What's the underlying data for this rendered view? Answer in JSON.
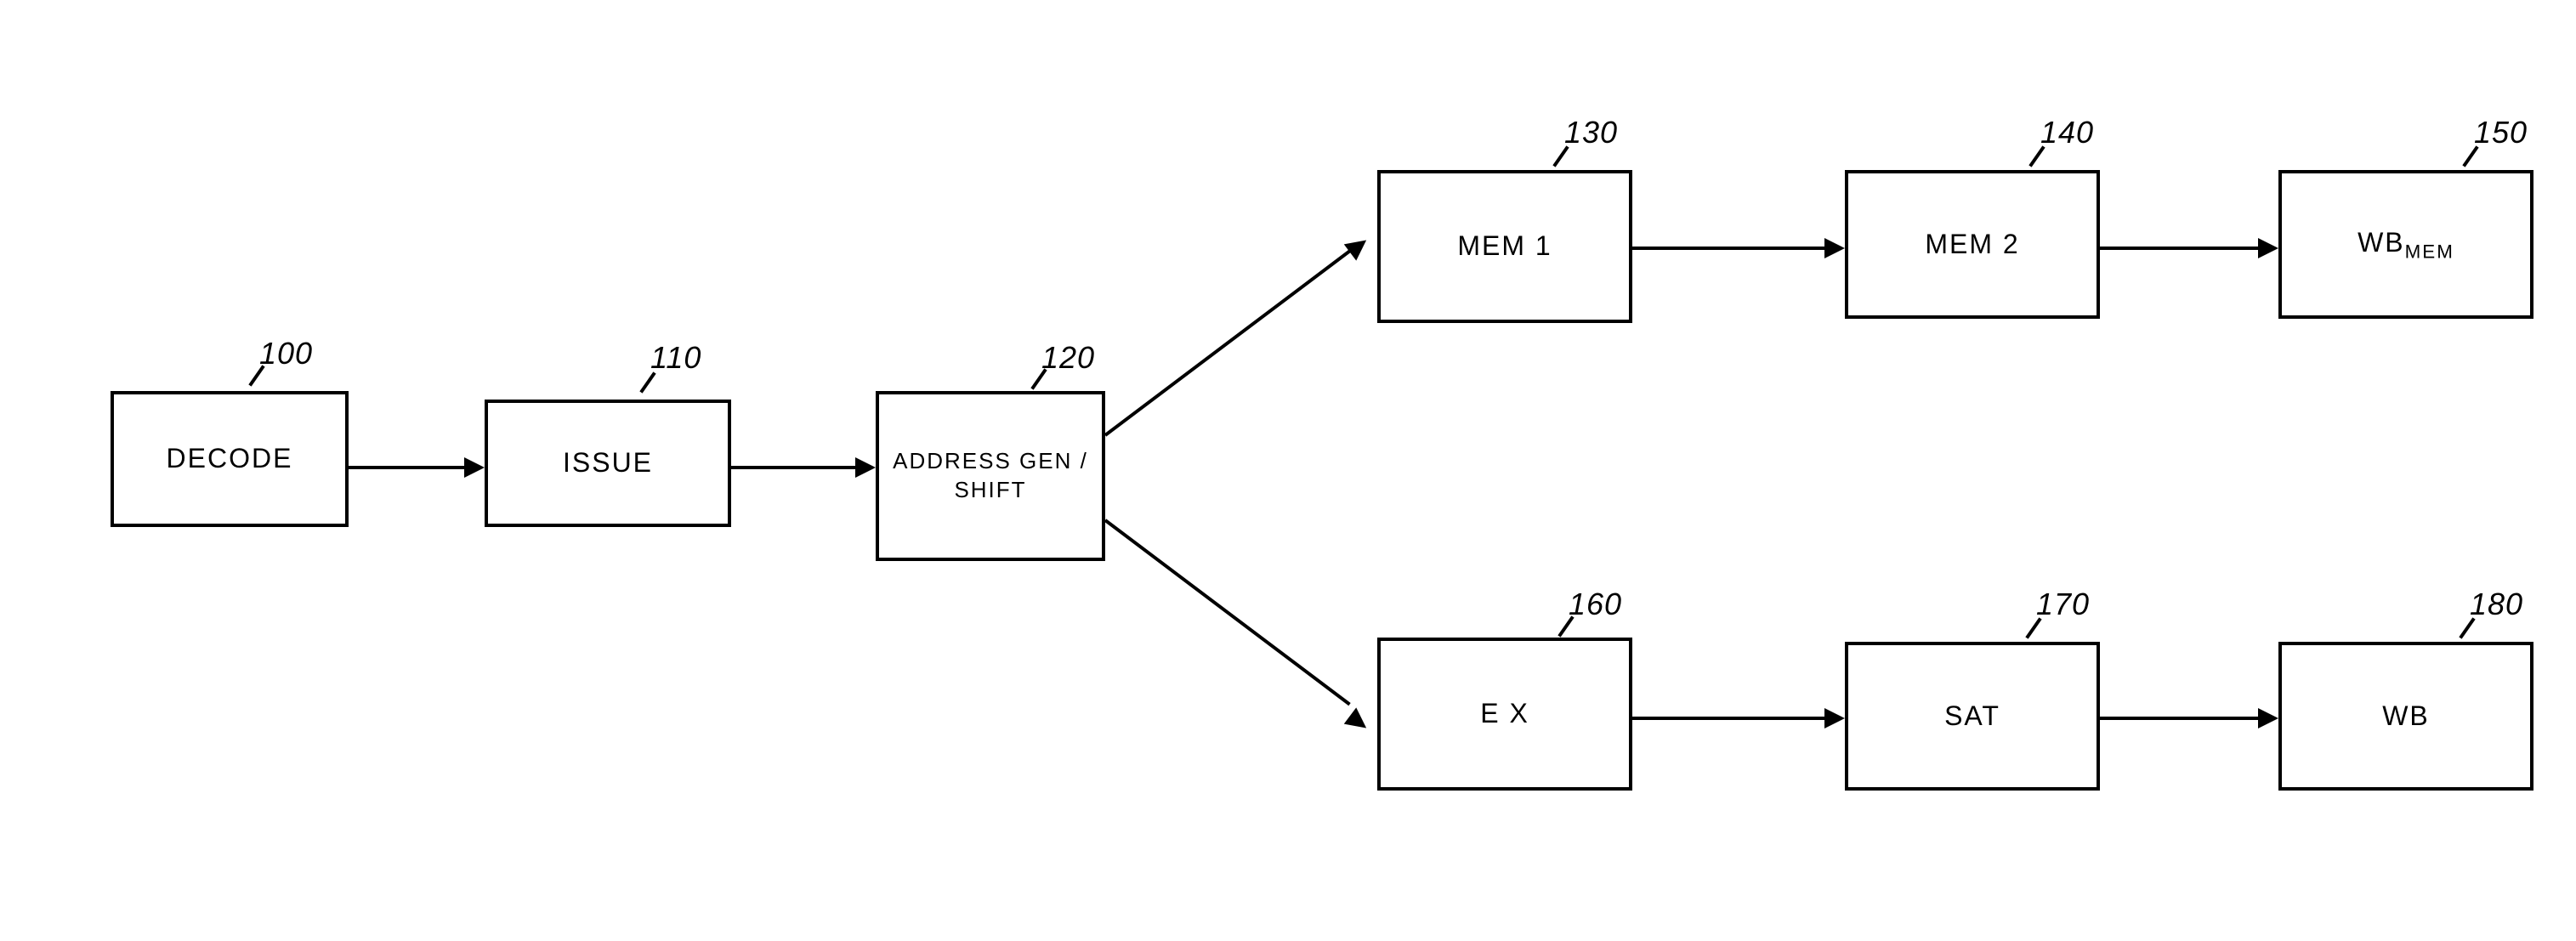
{
  "blocks": {
    "decode": {
      "label": "DECODE",
      "num": "100"
    },
    "issue": {
      "label": "ISSUE",
      "num": "110"
    },
    "addrgen": {
      "label": "ADDRESS GEN / SHIFT",
      "num": "120"
    },
    "mem1": {
      "label": "MEM 1",
      "num": "130"
    },
    "mem2": {
      "label": "MEM 2",
      "num": "140"
    },
    "wbmem": {
      "label_main": "WB",
      "label_sub": "MEM",
      "num": "150"
    },
    "ex": {
      "label": "E X",
      "num": "160"
    },
    "sat": {
      "label": "SAT",
      "num": "170"
    },
    "wb": {
      "label": "WB",
      "num": "180"
    }
  }
}
